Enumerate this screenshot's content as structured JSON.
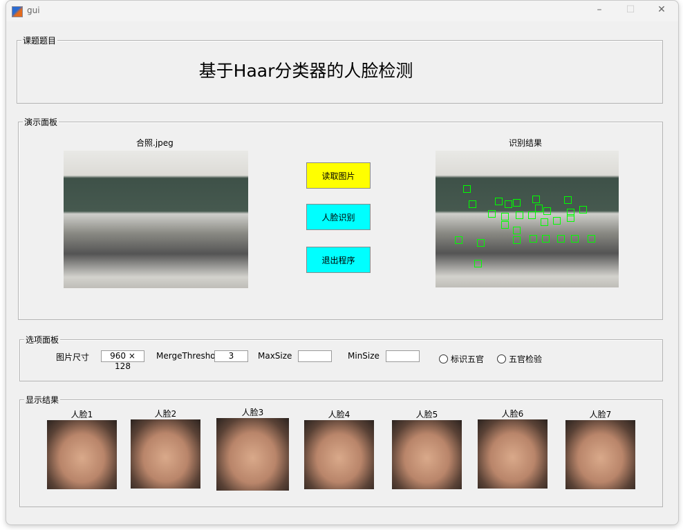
{
  "window": {
    "title": "gui",
    "controls": {
      "minimize": "–",
      "maximize": "☐",
      "close": "✕"
    }
  },
  "title_panel": {
    "label": "课题题目",
    "title": "基于Haar分类器的人脸检测"
  },
  "demo_panel": {
    "label": "演示面板",
    "input_image_title": "合照.jpeg",
    "result_image_title": "识别结果",
    "buttons": {
      "read": "读取图片",
      "detect": "人脸识别",
      "exit": "退出程序"
    },
    "colors": {
      "read": "#ffff00",
      "detect": "#00ffff",
      "exit": "#00ffff",
      "detection_box": "#00ff00"
    }
  },
  "options_panel": {
    "label": "选项面板",
    "image_size_label": "图片尺寸",
    "image_size_value": "960 × 128",
    "merge_threshold_label": "MergeThresho",
    "merge_threshold_value": "3",
    "max_size_label": "MaxSize",
    "max_size_value": "",
    "min_size_label": "MinSize",
    "min_size_value": "",
    "radio_mark_features": {
      "label": "标识五官",
      "checked": false
    },
    "radio_feature_check": {
      "label": "五官检验",
      "checked": false
    }
  },
  "results_panel": {
    "label": "显示结果",
    "faces": [
      "人脸1",
      "人脸2",
      "人脸3",
      "人脸4",
      "人脸5",
      "人脸6",
      "人脸7"
    ]
  }
}
